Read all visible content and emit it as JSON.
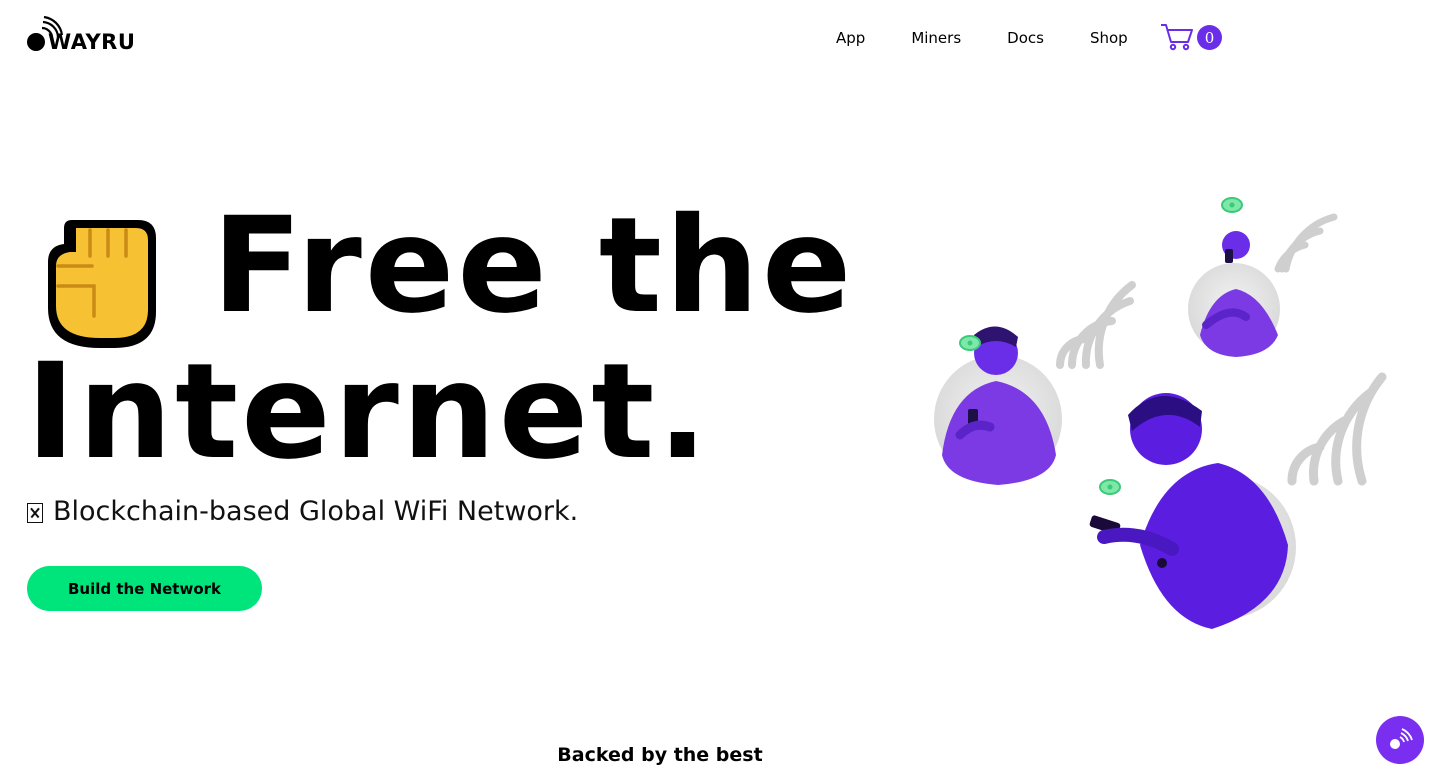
{
  "brand": {
    "name": "WAYRU",
    "accent": "#6a2ee8",
    "cta_color": "#00e47c"
  },
  "nav": {
    "items": [
      {
        "label": "App"
      },
      {
        "label": "Miners"
      },
      {
        "label": "Docs"
      },
      {
        "label": "Shop"
      }
    ],
    "cart_icon": "shopping-cart-icon",
    "cart_count": "0"
  },
  "hero": {
    "line1": "Free the",
    "line2": "Internet.",
    "icon": "raised-fist-icon",
    "subtitle": "Blockchain-based Global WiFi Network.",
    "cta_label": "Build the Network"
  },
  "section": {
    "backed_title": "Backed by the best"
  },
  "chat": {
    "icon": "chat-wifi-icon"
  }
}
